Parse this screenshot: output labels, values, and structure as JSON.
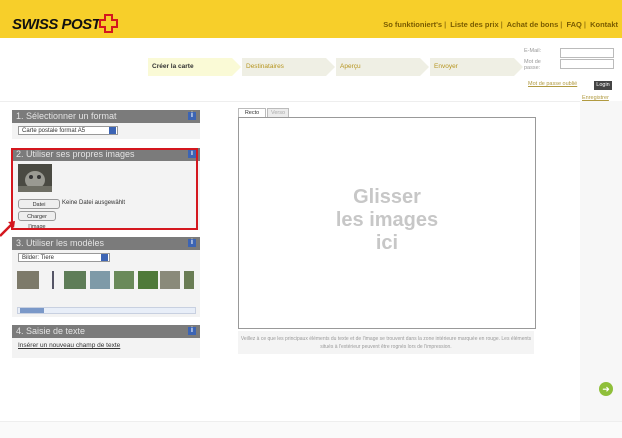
{
  "brand": {
    "name": "SWISS POST",
    "cross_color": "#d4171e"
  },
  "topnav": [
    "So funktioniert's",
    "Liste des prix",
    "Achat de bons",
    "FAQ",
    "Kontakt"
  ],
  "steps": [
    {
      "label": "Créer la carte",
      "active": true
    },
    {
      "label": "Destinataires",
      "active": false
    },
    {
      "label": "Aperçu",
      "active": false
    },
    {
      "label": "Envoyer",
      "active": false
    }
  ],
  "login": {
    "email_label": "E-Mail:",
    "password_label": "Mot de passe:",
    "forgot_link": "Mot de passe oublié",
    "login_button": "Login",
    "register_link": "Enregistrer"
  },
  "panel1": {
    "title": "1. Sélectionner un format",
    "select_value": "Carte postale format A5"
  },
  "panel2": {
    "title": "2. Utiliser ses propres images",
    "choose_file_button": "Datei auswählen",
    "no_file_text": "Keine Datei ausgewählt",
    "upload_button": "Charger l'image"
  },
  "panel3": {
    "title": "3. Utiliser les modèles",
    "select_value": "Bilder: Tiere"
  },
  "panel4": {
    "title": "4. Saisie de texte",
    "link": "Insérer un nouveau champ de texte"
  },
  "canvas": {
    "tabs": [
      "Recto",
      "Verso"
    ],
    "drop_line1": "Glisser",
    "drop_line2": "les images",
    "drop_line3": "ici",
    "note": "Veillez à ce que les principaux éléments du texte et de l'image se trouvent dans la zone intérieure marquée en rouge. Les éléments situés à l'extérieur peuvent être rognés lors de l'impression."
  },
  "icons": {
    "info": "info-icon",
    "next": "next-arrow-icon"
  },
  "colors": {
    "brand_yellow": "#f7cf2a",
    "panel_header": "#7b7b7b",
    "info_blue": "#3c64b4",
    "highlight_red": "#d4171e",
    "next_green": "#8fbf3a"
  }
}
